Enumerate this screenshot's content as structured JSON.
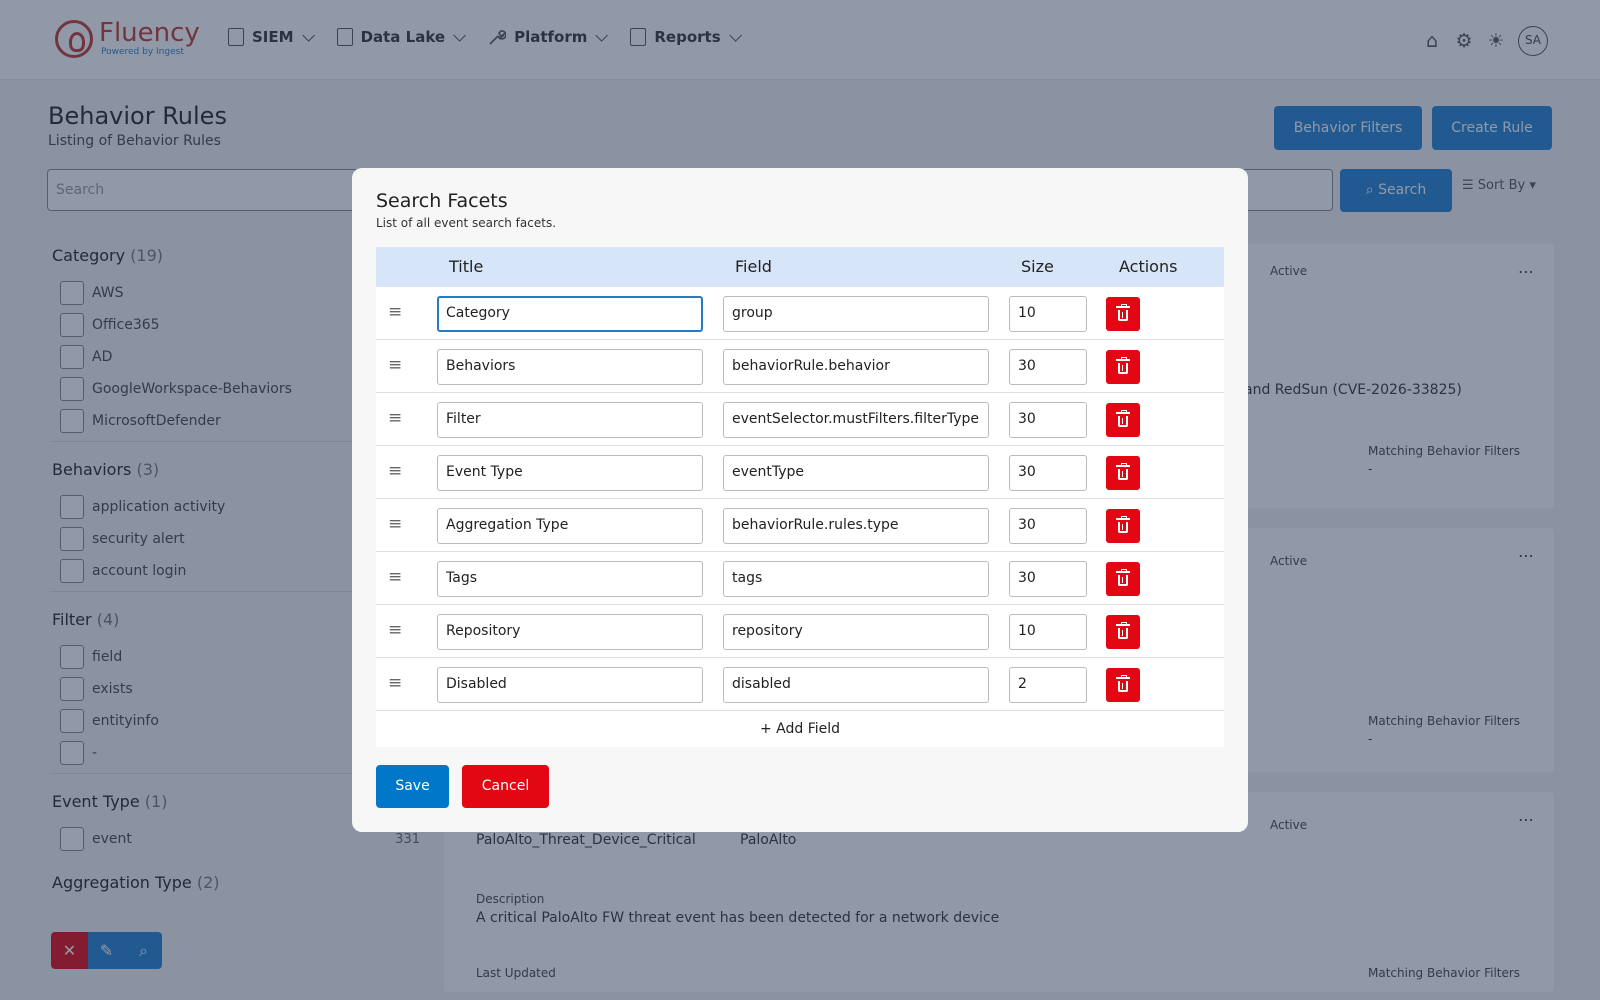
{
  "brand": {
    "name": "Fluency",
    "tagline": "Powered by Ingest"
  },
  "nav": {
    "items": [
      {
        "label": "SIEM",
        "icon": "search-doc-icon"
      },
      {
        "label": "Data Lake",
        "icon": "search-doc-icon"
      },
      {
        "label": "Platform",
        "icon": "wrench-icon"
      },
      {
        "label": "Reports",
        "icon": "report-icon"
      }
    ]
  },
  "user": {
    "initials": "SA"
  },
  "page": {
    "title": "Behavior Rules",
    "subtitle": "Listing of Behavior Rules",
    "behavior_filters_btn": "Behavior Filters",
    "create_rule_btn": "Create Rule",
    "search_placeholder": "Search",
    "search_btn": "Search",
    "sort_by": "Sort By"
  },
  "facets": [
    {
      "title": "Category",
      "count": "(19)",
      "items": [
        "AWS",
        "Office365",
        "AD",
        "GoogleWorkspace-Behaviors",
        "MicrosoftDefender"
      ]
    },
    {
      "title": "Behaviors",
      "count": "(3)",
      "items": [
        "application activity",
        "security alert",
        "account login"
      ]
    },
    {
      "title": "Filter",
      "count": "(4)",
      "items": [
        "field",
        "exists",
        "entityinfo",
        "-"
      ]
    },
    {
      "title": "Event Type",
      "count": "(1)",
      "items": [
        "event"
      ],
      "counts": [
        "331"
      ]
    },
    {
      "title": "Aggregation Type",
      "count": "(2)",
      "items": []
    }
  ],
  "cards": {
    "active_label": "Active",
    "card1_desc_partial": "and RedSun (CVE-2026-33825)",
    "matching_label": "Matching Behavior Filters",
    "matching_value": "-",
    "card3_name": "PaloAlto_Threat_Device_Critical",
    "card3_category": "PaloAlto",
    "description_label": "Description",
    "card3_desc": "A critical PaloAlto FW threat event has been detected for a network device",
    "last_updated_label": "Last Updated"
  },
  "modal": {
    "title": "Search Facets",
    "subtitle": "List of all event search facets.",
    "columns": {
      "title": "Title",
      "field": "Field",
      "size": "Size",
      "actions": "Actions"
    },
    "rows": [
      {
        "title": "Category",
        "field": "group",
        "size": "10"
      },
      {
        "title": "Behaviors",
        "field": "behaviorRule.behavior",
        "size": "30"
      },
      {
        "title": "Filter",
        "field": "eventSelector.mustFilters.filterType",
        "size": "30"
      },
      {
        "title": "Event Type",
        "field": "eventType",
        "size": "30"
      },
      {
        "title": "Aggregation Type",
        "field": "behaviorRule.rules.type",
        "size": "30"
      },
      {
        "title": "Tags",
        "field": "tags",
        "size": "30"
      },
      {
        "title": "Repository",
        "field": "repository",
        "size": "10"
      },
      {
        "title": "Disabled",
        "field": "disabled",
        "size": "2"
      }
    ],
    "add_field": "+ Add Field",
    "save": "Save",
    "cancel": "Cancel"
  },
  "colors": {
    "primary": "#0077c8",
    "danger": "#e30613",
    "header_row": "#d6e6f8"
  }
}
